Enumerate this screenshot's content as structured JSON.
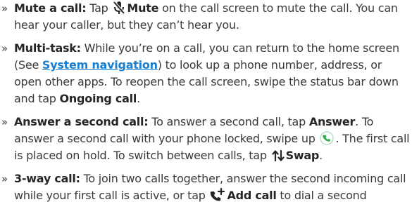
{
  "items": [
    {
      "title": "Mute a call:",
      "text_1": " Tap ",
      "icon": "mic-off-icon",
      "action": "Mute",
      "text_2": " on the call screen to mute the call. You can hear your caller, but they can’t hear you."
    },
    {
      "title": "Multi-task:",
      "text_1": " While you’re on a call, you can return to the home screen (See ",
      "link": "System navigation",
      "text_2": ") to look up a phone number, address, or open other apps. To reopen the call screen, swipe the status bar down and tap ",
      "action": "Ongoing call",
      "text_3": "."
    },
    {
      "title": "Answer a second call:",
      "text_1": " To answer a second call, tap ",
      "action": "Answer",
      "text_2": ". To answer a second call with your phone locked, swipe up ",
      "icon_1": "phone-answer-icon",
      "text_3": ". The first call is placed on hold. To switch between calls, tap ",
      "icon_2": "swap-icon",
      "action_2": "Swap",
      "text_4": "."
    },
    {
      "title": "3-way call:",
      "text_1": " To join two calls together, answer the second incoming call while your first call is active, or tap ",
      "icon": "add-call-icon",
      "action": "Add call",
      "text_2": " to dial a second"
    }
  ],
  "colors": {
    "text": "#3a3a3a",
    "bold": "#262626",
    "link": "#1a7fd0",
    "answer_icon": "#34a853"
  }
}
